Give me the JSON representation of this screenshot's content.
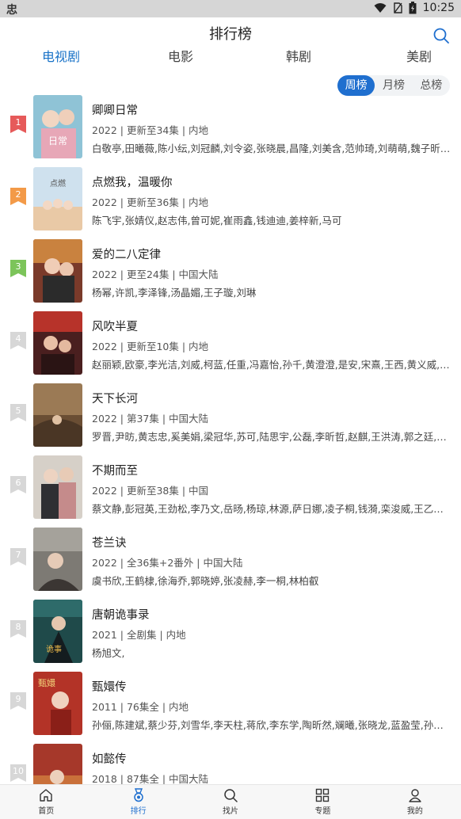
{
  "status": {
    "time": "10:25",
    "app_glyph": "忠"
  },
  "header": {
    "title": "排行榜"
  },
  "categories": [
    {
      "label": "电视剧",
      "active": true
    },
    {
      "label": "电影",
      "active": false
    },
    {
      "label": "韩剧",
      "active": false
    },
    {
      "label": "美剧",
      "active": false
    }
  ],
  "ranking_period": {
    "options": [
      "周榜",
      "月榜",
      "总榜"
    ],
    "selected": "周榜"
  },
  "colors": {
    "accent": "#1f6fcf",
    "rank1": "#e65a5a",
    "rank2": "#f39a48",
    "rank3": "#7cc45a",
    "rank_other": "#d7d7d7"
  },
  "items": [
    {
      "rank": "1",
      "title": "卿卿日常",
      "meta": "2022 | 更新至34集 | 内地",
      "cast": "白敬亭,田曦薇,陈小纭,刘冠麟,刘令姿,张晓晨,昌隆,刘美含,范帅琦,刘萌萌,魏子昕,陈..."
    },
    {
      "rank": "2",
      "title": "点燃我，温暖你",
      "meta": "2022 | 更新至36集 | 内地",
      "cast": "陈飞宇,张婧仪,赵志伟,曾可妮,崔雨鑫,钱迪迪,姜梓新,马可"
    },
    {
      "rank": "3",
      "title": "爱的二八定律",
      "meta": "2022 | 更至24集 | 中国大陆",
      "cast": "杨幂,许凯,李泽锋,汤晶媚,王子璇,刘琳"
    },
    {
      "rank": "4",
      "title": "风吹半夏",
      "meta": "2022 | 更新至10集 | 内地",
      "cast": "赵丽颖,欧豪,李光洁,刘威,柯蓝,任重,冯嘉怡,孙千,黄澄澄,是安,宋熹,王西,黄义威,王..."
    },
    {
      "rank": "5",
      "title": "天下长河",
      "meta": "2022 | 第37集 | 中国大陆",
      "cast": "罗晋,尹昉,黄志忠,奚美娟,梁冠华,苏可,陆思宇,公磊,李昕哲,赵麒,王洪涛,郭之廷,刘天..."
    },
    {
      "rank": "6",
      "title": "不期而至",
      "meta": "2022 | 更新至38集 | 中国",
      "cast": "蔡文静,彭冠英,王劲松,李乃文,岳旸,杨琼,林源,萨日娜,凌子桐,钱漪,栾浚威,王乙竹,王..."
    },
    {
      "rank": "7",
      "title": "苍兰诀",
      "meta": "2022 | 全36集+2番外 | 中国大陆",
      "cast": "虞书欣,王鹤棣,徐海乔,郭晓婷,张凌赫,李一桐,林柏叡"
    },
    {
      "rank": "8",
      "title": "唐朝诡事录",
      "meta": "2021 | 全剧集 | 内地",
      "cast": "杨旭文,"
    },
    {
      "rank": "9",
      "title": "甄嬛传",
      "meta": "2011 | 76集全 | 内地",
      "cast": "孙俪,陈建斌,蔡少芬,刘雪华,李天柱,蒋欣,李东学,陶昕然,斓曦,张晓龙,蓝盈莹,孙茜,战..."
    },
    {
      "rank": "10",
      "title": "如懿传",
      "meta": "2018 | 87集全 | 中国大陆",
      "cast": ""
    }
  ],
  "bottom_nav": [
    {
      "label": "首页",
      "icon": "home-icon",
      "active": false
    },
    {
      "label": "排行",
      "icon": "medal-icon",
      "active": true
    },
    {
      "label": "找片",
      "icon": "search-icon",
      "active": false
    },
    {
      "label": "专题",
      "icon": "grid-icon",
      "active": false
    },
    {
      "label": "我的",
      "icon": "user-icon",
      "active": false
    }
  ]
}
